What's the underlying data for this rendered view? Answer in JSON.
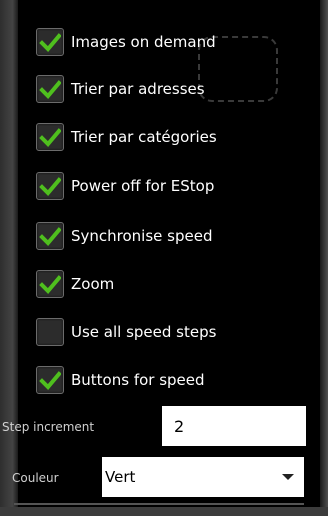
{
  "checkboxes": [
    {
      "label": "Images on demand",
      "checked": true
    },
    {
      "label": "Trier par adresses",
      "checked": true
    },
    {
      "label": "Trier par catégories",
      "checked": true
    },
    {
      "label": "Power off for EStop",
      "checked": true
    },
    {
      "label": "Synchronise speed",
      "checked": true
    },
    {
      "label": "Zoom",
      "checked": true
    },
    {
      "label": "Use all speed steps",
      "checked": false
    },
    {
      "label": "Buttons for speed",
      "checked": true
    }
  ],
  "step_increment": {
    "label": "Step increment",
    "value": "2"
  },
  "color_select": {
    "label": "Couleur",
    "selected": "Vert"
  },
  "colors": {
    "check": "#4fbf1e",
    "background": "#000000"
  }
}
